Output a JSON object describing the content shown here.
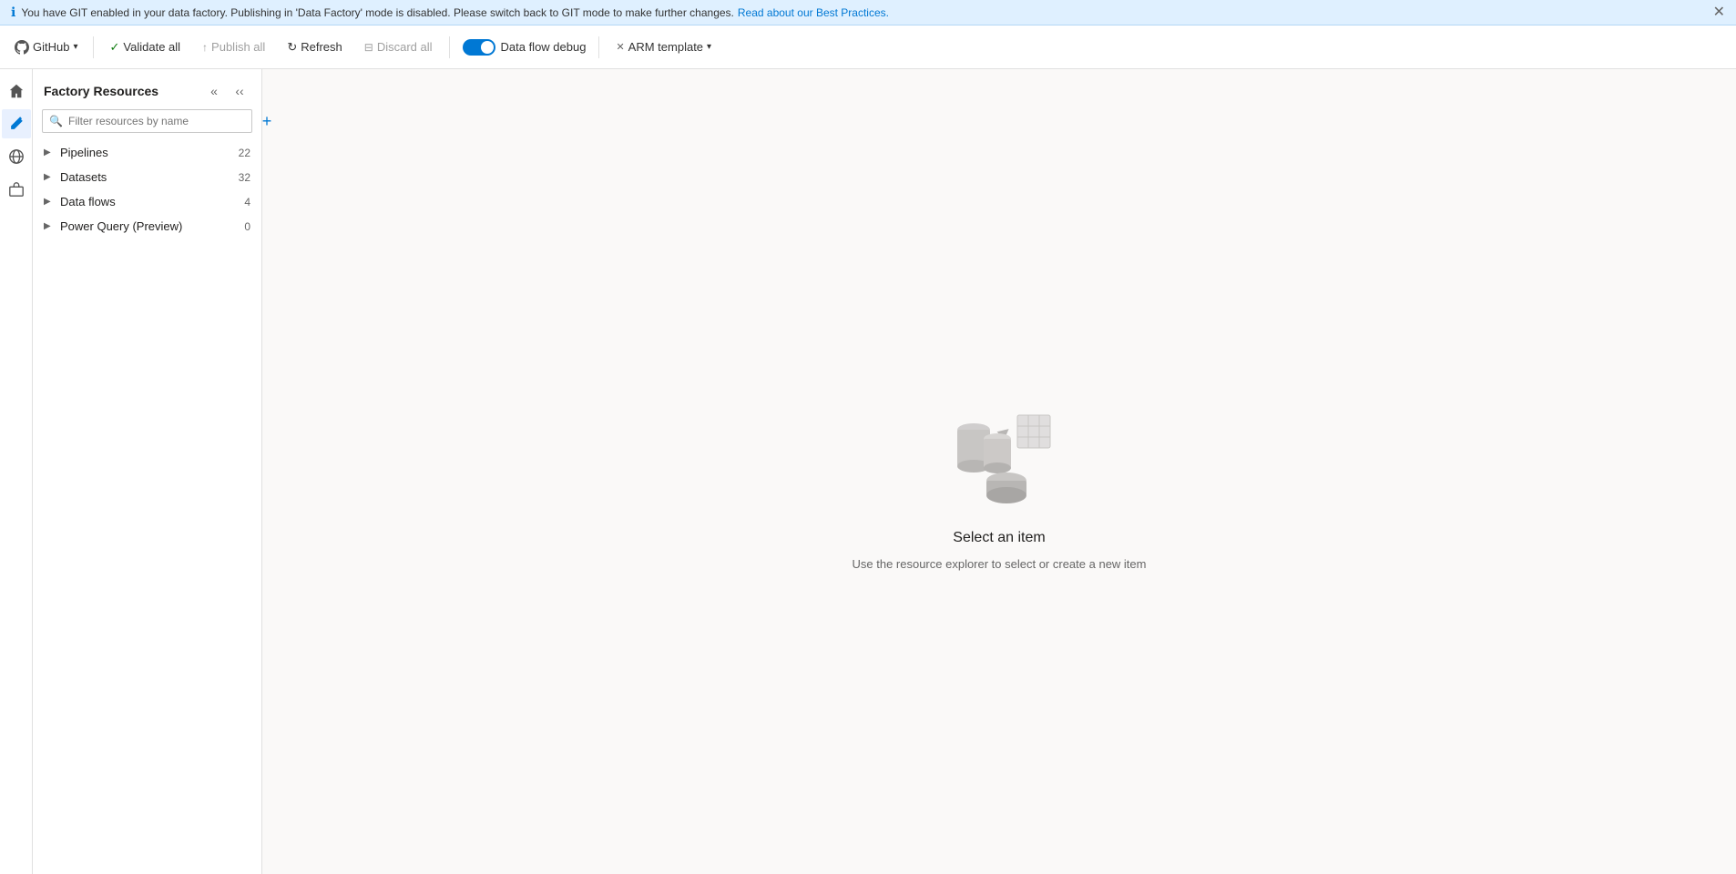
{
  "infobar": {
    "message": "You have GIT enabled in your data factory. Publishing in 'Data Factory' mode is disabled. Please switch back to GIT mode to make further changes.",
    "link_text": "Read about our Best Practices.",
    "icon": "ℹ"
  },
  "toolbar": {
    "github_label": "GitHub",
    "validate_label": "Validate all",
    "publish_label": "Publish all",
    "refresh_label": "Refresh",
    "discard_label": "Discard all",
    "dataflow_debug_label": "Data flow debug",
    "arm_template_label": "ARM template"
  },
  "sidebar": {
    "title": "Factory Resources",
    "search_placeholder": "Filter resources by name",
    "items": [
      {
        "label": "Pipelines",
        "count": "22"
      },
      {
        "label": "Datasets",
        "count": "32"
      },
      {
        "label": "Data flows",
        "count": "4"
      },
      {
        "label": "Power Query (Preview)",
        "count": "0"
      }
    ]
  },
  "empty_state": {
    "title": "Select an item",
    "subtitle": "Use the resource explorer to select or create a new item"
  },
  "nav_icons": [
    {
      "name": "home-icon",
      "icon": "⌂"
    },
    {
      "name": "pencil-icon",
      "icon": "✏"
    },
    {
      "name": "globe-icon",
      "icon": "◉"
    },
    {
      "name": "briefcase-icon",
      "icon": "⊞"
    }
  ]
}
